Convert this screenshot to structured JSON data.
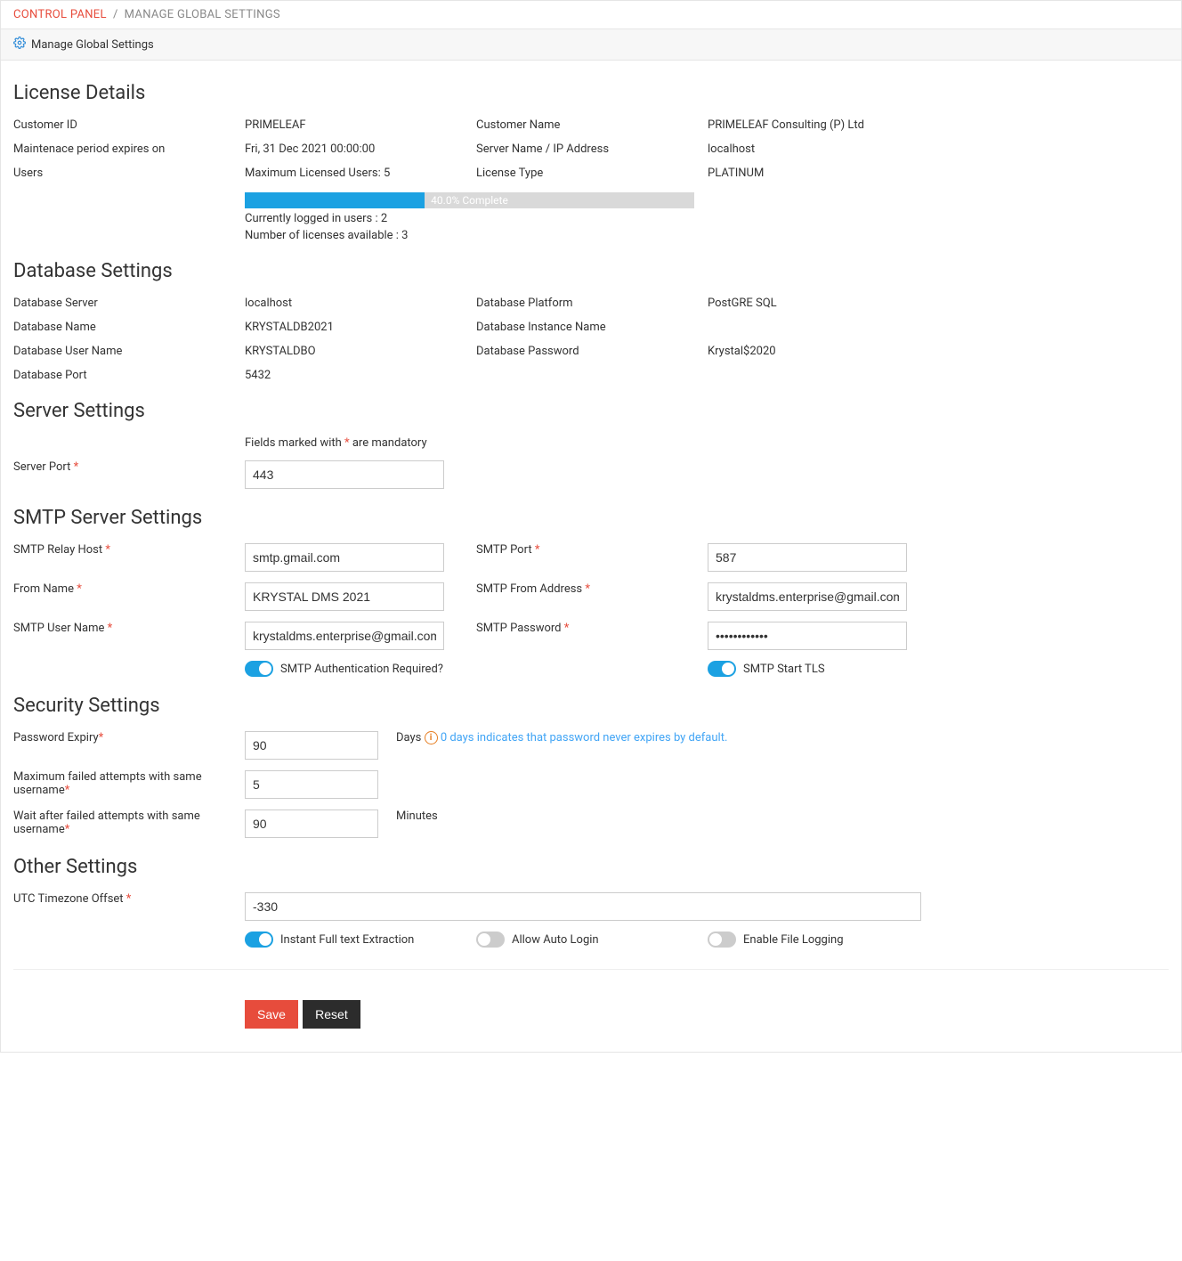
{
  "breadcrumb": {
    "root": "CONTROL PANEL",
    "leaf": "MANAGE GLOBAL SETTINGS"
  },
  "panel_title": "Manage Global Settings",
  "sections": {
    "license": {
      "title": "License Details",
      "customer_id_label": "Customer ID",
      "customer_id": "PRIMELEAF",
      "customer_name_label": "Customer Name",
      "customer_name": "PRIMELEAF Consulting (P) Ltd",
      "maint_label": "Maintenace period expires on",
      "maint_value": "Fri, 31 Dec 2021 00:00:00",
      "server_label": "Server Name / IP Address",
      "server_value": "localhost",
      "users_label": "Users",
      "users_value": "Maximum Licensed Users: 5",
      "lic_type_label": "License Type",
      "lic_type_value": "PLATINUM",
      "progress_text": "40.0% Complete",
      "logged_in": "Currently logged in users : 2",
      "avail": "Number of licenses available : 3"
    },
    "db": {
      "title": "Database Settings",
      "server_label": "Database Server",
      "server": "localhost",
      "platform_label": "Database Platform",
      "platform": "PostGRE SQL",
      "name_label": "Database Name",
      "name": "KRYSTALDB2021",
      "instance_label": "Database Instance Name",
      "instance": "",
      "user_label": "Database User Name",
      "user": "KRYSTALDBO",
      "pass_label": "Database Password",
      "pass": "Krystal$2020",
      "port_label": "Database Port",
      "port": "5432"
    },
    "server": {
      "title": "Server Settings",
      "mandatory_note_pre": "Fields marked with ",
      "mandatory_note_post": " are mandatory",
      "port_label": "Server Port ",
      "port": "443"
    },
    "smtp": {
      "title": "SMTP Server Settings",
      "relay_label": "SMTP Relay Host ",
      "relay": "smtp.gmail.com",
      "port_label": "SMTP Port ",
      "port": "587",
      "from_name_label": "From Name ",
      "from_name": "KRYSTAL DMS 2021",
      "from_addr_label": "SMTP From Address ",
      "from_addr": "krystaldms.enterprise@gmail.com",
      "user_label": "SMTP User Name ",
      "user": "krystaldms.enterprise@gmail.com",
      "pass_label": "SMTP Password ",
      "pass": "••••••••••••",
      "auth_label": "SMTP Authentication Required?",
      "tls_label": "SMTP Start TLS"
    },
    "security": {
      "title": "Security Settings",
      "expiry_label": "Password Expiry",
      "expiry": "90",
      "expiry_unit": "Days ",
      "expiry_hint": " 0 days indicates that password never expires by default.",
      "maxfail_label": "Maximum failed attempts with same username",
      "maxfail": "5",
      "wait_label": "Wait after failed attempts with same username",
      "wait": "90",
      "wait_unit": "Minutes"
    },
    "other": {
      "title": "Other Settings",
      "tz_label": "UTC Timezone Offset ",
      "tz": "-330",
      "fulltext_label": "Instant Full text Extraction",
      "autologin_label": "Allow Auto Login",
      "filelog_label": "Enable File Logging"
    }
  },
  "buttons": {
    "save": "Save",
    "reset": "Reset"
  }
}
